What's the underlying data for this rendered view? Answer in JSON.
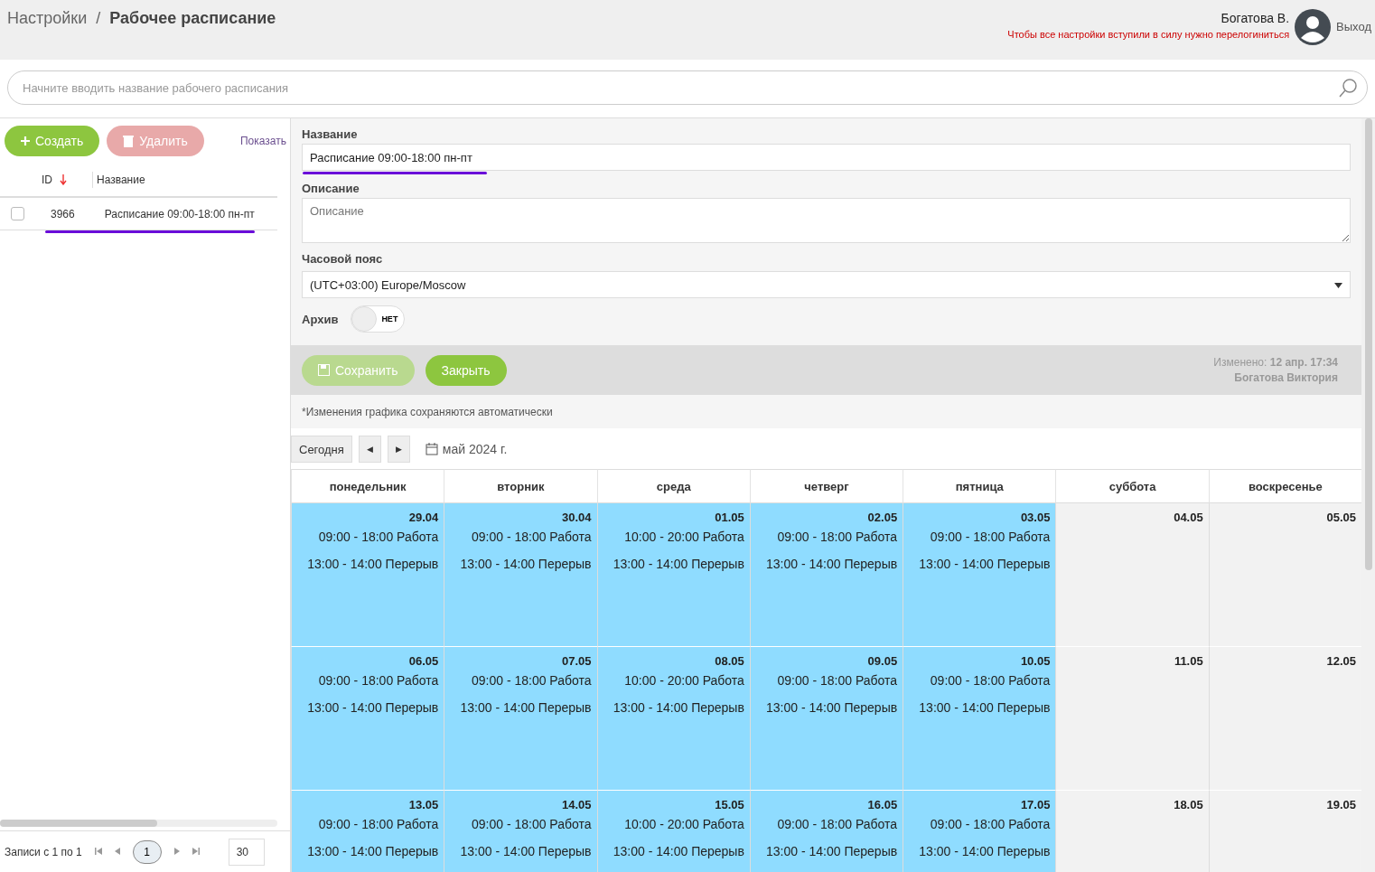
{
  "breadcrumb": {
    "parent": "Настройки",
    "separator": "/",
    "current": "Рабочее расписание"
  },
  "user": {
    "name": "Богатова В.",
    "warning": "Чтобы все настройки вступили в силу нужно перелогиниться",
    "logout": "Выход"
  },
  "search": {
    "placeholder": "Начните вводить название рабочего расписания"
  },
  "list": {
    "create": "Создать",
    "delete": "Удалить",
    "delete_disabled": true,
    "show": "Показать",
    "columns": [
      {
        "label": "ID",
        "sorted": true
      },
      {
        "label": "Название",
        "sorted": false
      }
    ],
    "rows": [
      {
        "id": "3966",
        "name": "Расписание 09:00-18:00 пн-пт",
        "checked": false,
        "underlined": true
      }
    ],
    "records": "Записи с 1 по 1",
    "pages": [
      {
        "label": "1",
        "selected": true
      }
    ],
    "page_size": "30"
  },
  "form": {
    "name_label": "Название",
    "name_value": "Расписание 09:00-18:00 пн-пт",
    "name_underlined": true,
    "description_label": "Описание",
    "description_placeholder": "Описание",
    "timezone_label": "Часовой пояс",
    "timezone_value": "(UTC+03:00) Europe/Moscow",
    "archive_label": "Архив",
    "archive": {
      "on": false,
      "text": "НЕТ"
    },
    "save": "Сохранить",
    "save_disabled": true,
    "close": "Закрыть",
    "modified_label": "Изменено:",
    "modified_date": "12 апр. 17:34",
    "modified_by": "Богатова Виктория",
    "note": "*Изменения графика сохраняются автоматически"
  },
  "calendar": {
    "today": "Сегодня",
    "prev": "◀",
    "next": "▶",
    "month": "май 2024 г.",
    "weekdays": [
      "понедельник",
      "вторник",
      "среда",
      "четверг",
      "пятница",
      "суббота",
      "воскресенье"
    ],
    "weeks": [
      [
        {
          "date": "29.04",
          "working": true,
          "events": [
            "09:00 - 18:00 Работа",
            "13:00 - 14:00 Перерыв"
          ]
        },
        {
          "date": "30.04",
          "working": true,
          "events": [
            "09:00 - 18:00 Работа",
            "13:00 - 14:00 Перерыв"
          ]
        },
        {
          "date": "01.05",
          "working": true,
          "events": [
            "10:00 - 20:00 Работа",
            "13:00 - 14:00 Перерыв"
          ]
        },
        {
          "date": "02.05",
          "working": true,
          "events": [
            "09:00 - 18:00 Работа",
            "13:00 - 14:00 Перерыв"
          ]
        },
        {
          "date": "03.05",
          "working": true,
          "events": [
            "09:00 - 18:00 Работа",
            "13:00 - 14:00 Перерыв"
          ]
        },
        {
          "date": "04.05",
          "working": false
        },
        {
          "date": "05.05",
          "working": false
        }
      ],
      [
        {
          "date": "06.05",
          "working": true,
          "events": [
            "09:00 - 18:00 Работа",
            "13:00 - 14:00 Перерыв"
          ]
        },
        {
          "date": "07.05",
          "working": true,
          "events": [
            "09:00 - 18:00 Работа",
            "13:00 - 14:00 Перерыв"
          ]
        },
        {
          "date": "08.05",
          "working": true,
          "events": [
            "10:00 - 20:00 Работа",
            "13:00 - 14:00 Перерыв"
          ]
        },
        {
          "date": "09.05",
          "working": true,
          "events": [
            "09:00 - 18:00 Работа",
            "13:00 - 14:00 Перерыв"
          ]
        },
        {
          "date": "10.05",
          "working": true,
          "events": [
            "09:00 - 18:00 Работа",
            "13:00 - 14:00 Перерыв"
          ]
        },
        {
          "date": "11.05",
          "working": false
        },
        {
          "date": "12.05",
          "working": false
        }
      ],
      [
        {
          "date": "13.05",
          "working": true,
          "events": [
            "09:00 - 18:00 Работа",
            "13:00 - 14:00 Перерыв"
          ]
        },
        {
          "date": "14.05",
          "working": true,
          "events": [
            "09:00 - 18:00 Работа",
            "13:00 - 14:00 Перерыв"
          ]
        },
        {
          "date": "15.05",
          "working": true,
          "events": [
            "10:00 - 20:00 Работа",
            "13:00 - 14:00 Перерыв"
          ]
        },
        {
          "date": "16.05",
          "working": true,
          "events": [
            "09:00 - 18:00 Работа",
            "13:00 - 14:00 Перерыв"
          ]
        },
        {
          "date": "17.05",
          "working": true,
          "events": [
            "09:00 - 18:00 Работа",
            "13:00 - 14:00 Перерыв"
          ]
        },
        {
          "date": "18.05",
          "working": false
        },
        {
          "date": "19.05",
          "working": false
        }
      ]
    ]
  }
}
